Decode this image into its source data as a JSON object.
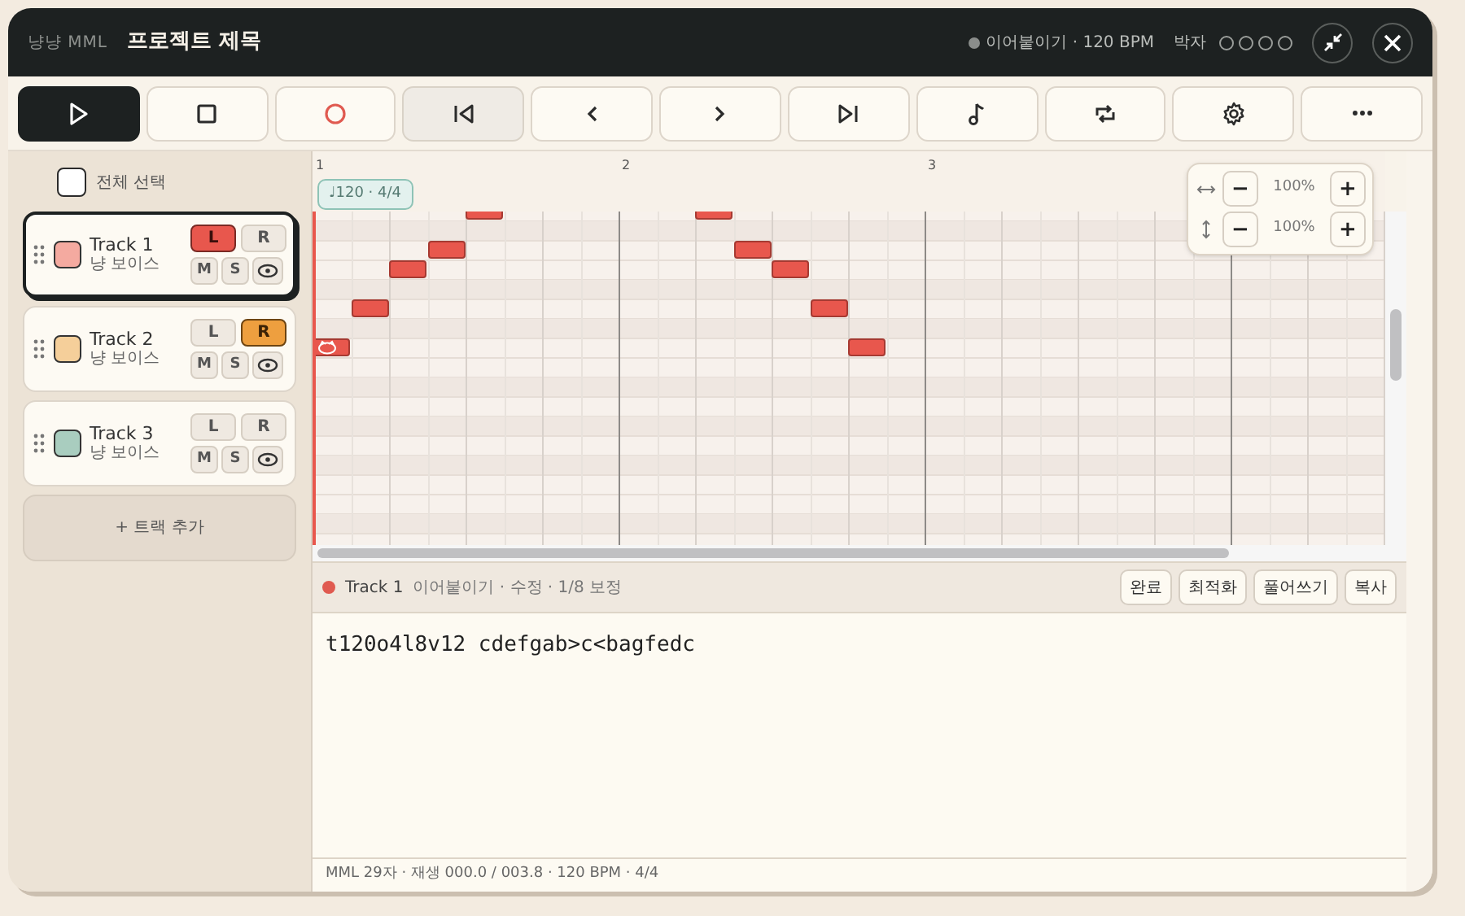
{
  "app_name": "냥냥 MML",
  "project_title": "프로젝트 제목",
  "status": {
    "text": "이어붙이기 · 120 BPM",
    "beat_label": "박자",
    "beats": [
      {
        "on": false
      },
      {
        "on": false
      },
      {
        "on": false
      },
      {
        "on": false
      }
    ]
  },
  "toolbar": [
    {
      "kind": "play",
      "selected": true,
      "highlighted": false
    },
    {
      "kind": "stop",
      "selected": false,
      "highlighted": false
    },
    {
      "kind": "record",
      "selected": false,
      "highlighted": false
    },
    {
      "kind": "rewind",
      "selected": false,
      "highlighted": true
    },
    {
      "kind": "prev",
      "selected": false,
      "highlighted": false
    },
    {
      "kind": "next",
      "selected": false,
      "highlighted": false
    },
    {
      "kind": "end",
      "selected": false,
      "highlighted": false
    },
    {
      "kind": "note",
      "selected": false,
      "highlighted": false
    },
    {
      "kind": "loop",
      "selected": false,
      "highlighted": false
    },
    {
      "kind": "settings",
      "selected": false,
      "highlighted": false
    },
    {
      "kind": "more",
      "selected": false,
      "highlighted": false
    }
  ],
  "select_all": {
    "label": "전체 선택",
    "checked": false
  },
  "tracks": [
    {
      "name": "Track 1",
      "voice": "냥 보이스",
      "color": "#f4aaa0",
      "selected": true,
      "left": {
        "label": "L",
        "on": true
      },
      "right": {
        "label": "R",
        "on": false
      },
      "mute": "M",
      "solo": "S"
    },
    {
      "name": "Track 2",
      "voice": "냥 보이스",
      "color": "#f5cf9a",
      "selected": false,
      "left": {
        "label": "L",
        "on": false
      },
      "right": {
        "label": "R",
        "on": true
      },
      "mute": "M",
      "solo": "S"
    },
    {
      "name": "Track 3",
      "voice": "냥 보이스",
      "color": "#a9cdbf",
      "selected": false,
      "left": {
        "label": "L",
        "on": false
      },
      "right": {
        "label": "R",
        "on": false
      },
      "mute": "M",
      "solo": "S"
    }
  ],
  "add_track": "+ 트랙 추가",
  "ruler": {
    "measures": [
      "1",
      "2",
      "3"
    ],
    "tempo_badge": "♩120 · 4/4"
  },
  "zoom": [
    {
      "kind": "horizontal",
      "value": "100%",
      "minus": "−",
      "plus": "+"
    },
    {
      "kind": "vertical",
      "value": "100%",
      "minus": "−",
      "plus": "+"
    }
  ],
  "editor": {
    "track": "Track 1",
    "info": "이어붙이기 · 수정 · 1/8 보정",
    "buttons": [
      "완료",
      "최적화",
      "풀어쓰기",
      "복사"
    ],
    "code": "t120o4l8v12 cdefgab>c<bagfedc"
  },
  "footer": "MML 29자 · 재생 000.0 / 003.8 · 120 BPM · 4/4"
}
